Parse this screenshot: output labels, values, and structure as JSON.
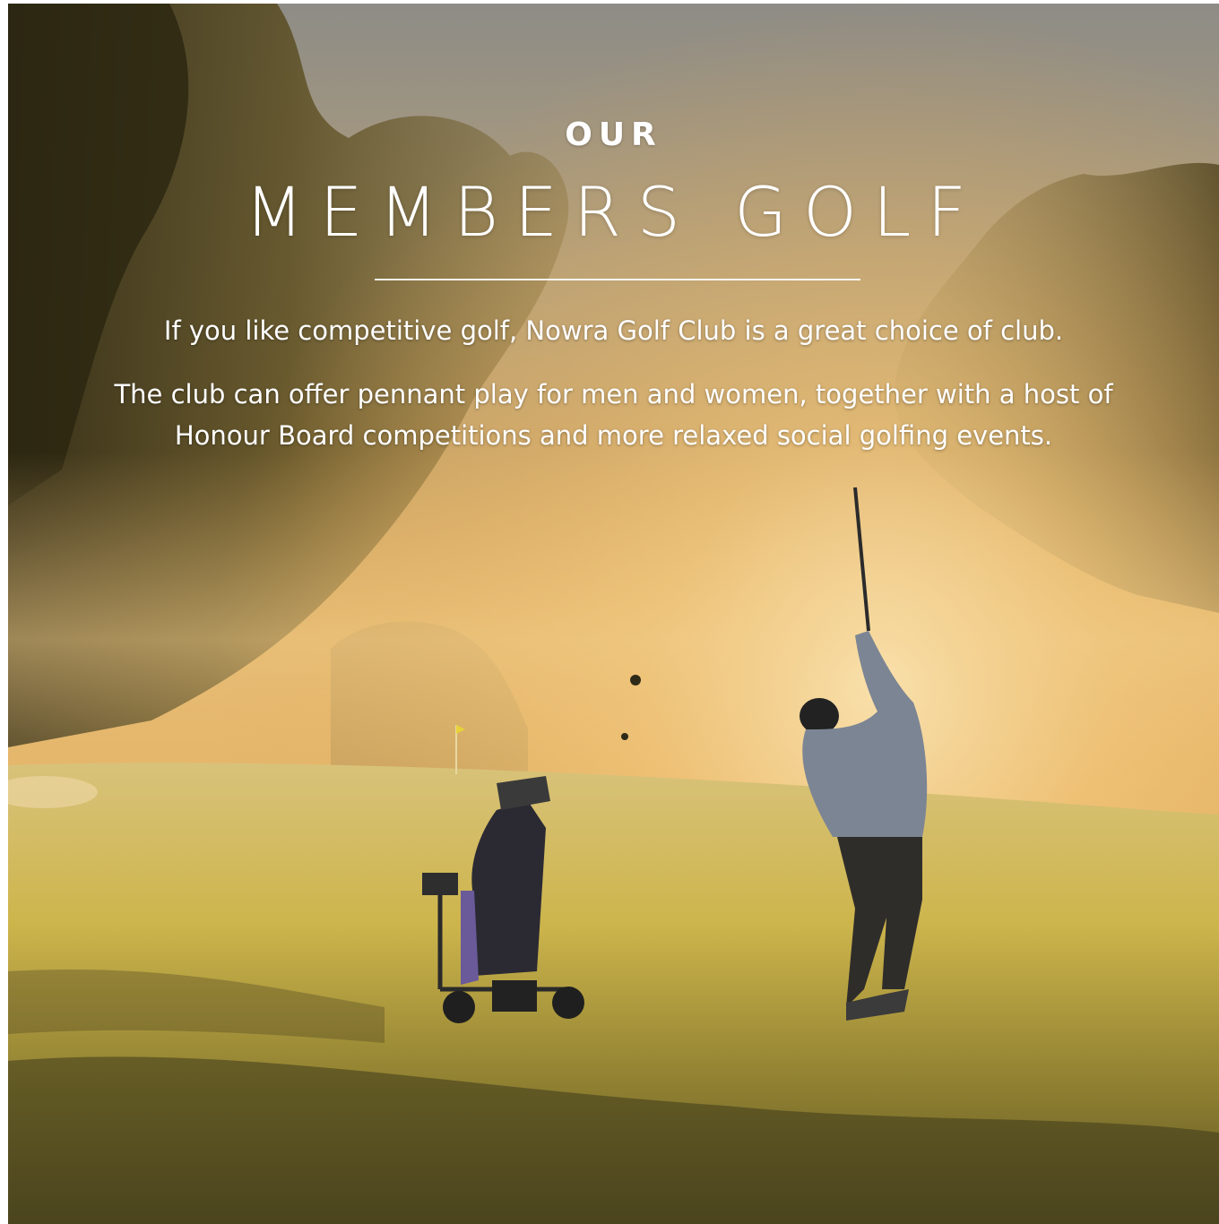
{
  "hero": {
    "eyebrow": "OUR",
    "title": "MEMBERS GOLF",
    "intro": "If you like competitive golf, Nowra Golf Club is a great choice of club.",
    "body": "The club can offer pennant play for men and women, together with a host of Honour Board competitions and more relaxed social golfing events."
  },
  "scene": {
    "icons": [
      "golfer-figure-icon",
      "golf-buggy-icon",
      "flag-pin-icon",
      "tree-canopy-icon"
    ],
    "colors": {
      "sky": "#9a9a9a",
      "haze": "#e8b868",
      "foliage_dark": "#3d3418",
      "fairway": "#c9b24a",
      "shadow": "#3a3418",
      "text": "#ffffff"
    }
  }
}
